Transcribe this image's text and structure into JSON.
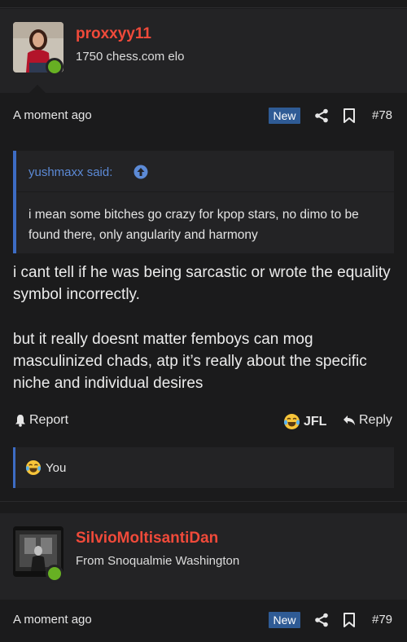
{
  "posts": [
    {
      "username": "proxxyy11",
      "user_title": "1750 chess.com elo",
      "time": "A moment ago",
      "badge": "New",
      "post_number": "#78",
      "quote": {
        "author": "yushmaxx said:",
        "text": "i mean some bitches go crazy for kpop stars, no dimo to be found there, only angularity and harmony"
      },
      "paragraphs": [
        "i cant tell if he was being sarcastic or wrote the equality symbol incorrectly.",
        "but it really doesnt matter femboys can mog masculinized chads, atp it’s really about the specific niche and individual desires"
      ],
      "actions": {
        "report": "Report",
        "reaction": "JFL",
        "reply": "Reply"
      },
      "reactions_by": "You"
    },
    {
      "username": "SilvioMoltisantiDan",
      "user_title": "From Snoqualmie Washington",
      "time": "A moment ago",
      "badge": "New",
      "post_number": "#79"
    }
  ],
  "icons": {
    "share": "share-icon",
    "bookmark": "bookmark-icon",
    "quote_jump": "arrow-up-circle-icon",
    "report": "bell-icon",
    "reaction": "laughing-crying-emoji-icon",
    "reply": "reply-arrow-icon"
  },
  "colors": {
    "username": "#f04a3a",
    "accent": "#3d6cc4",
    "online": "#67b023",
    "badge": "#2f5b95"
  }
}
